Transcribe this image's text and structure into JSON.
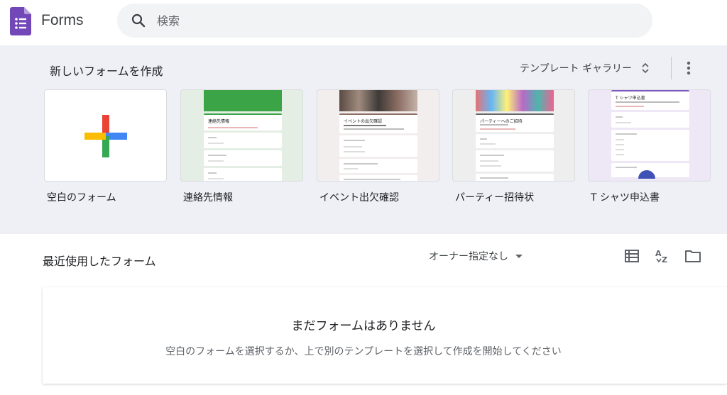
{
  "header": {
    "app_name": "Forms",
    "search_placeholder": "検索"
  },
  "templates": {
    "heading": "新しいフォームを作成",
    "gallery_label": "テンプレート ギャラリー",
    "items": [
      {
        "label": "空白のフォーム"
      },
      {
        "label": "連絡先情報",
        "preview_title": "連絡先情報"
      },
      {
        "label": "イベント出欠確認",
        "preview_title": "イベントの出欠確認"
      },
      {
        "label": "パーティー招待状",
        "preview_title": "パーティーへのご招待"
      },
      {
        "label": "T シャツ申込書",
        "preview_title": "T シャツ申込書"
      }
    ]
  },
  "recent": {
    "heading": "最近使用したフォーム",
    "owner_filter": "オーナー指定なし",
    "empty_title": "まだフォームはありません",
    "empty_desc": "空白のフォームを選択するか、上で別のテンプレートを選択して作成を開始してください"
  },
  "colors": {
    "brand": "#673ab7",
    "green": "#34a853",
    "red": "#ea4335",
    "yellow": "#fbbc04",
    "blue": "#4285f4"
  }
}
